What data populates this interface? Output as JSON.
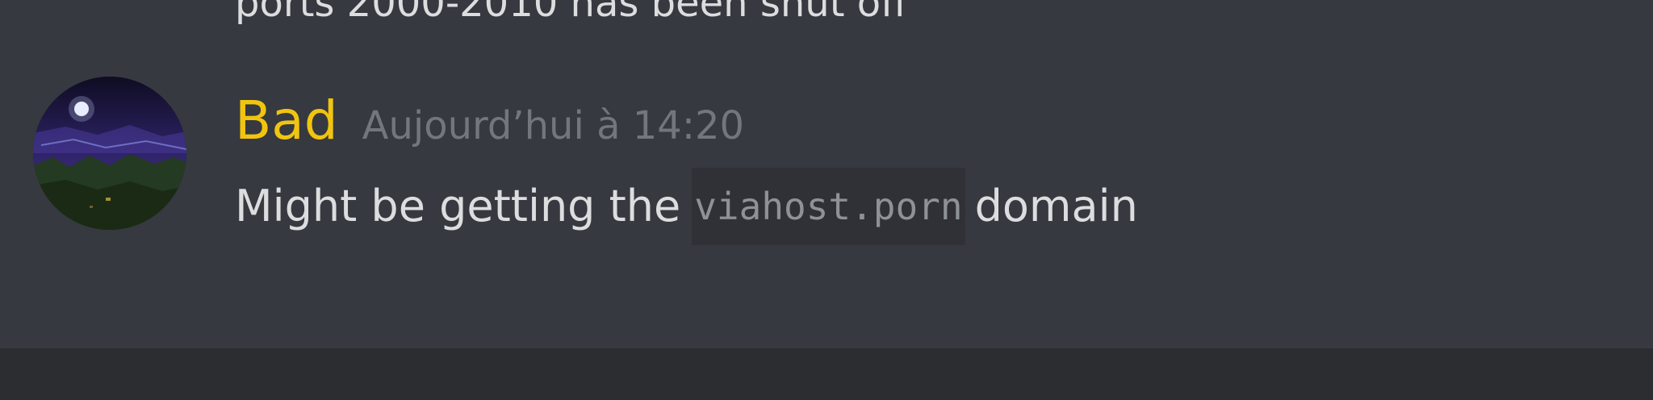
{
  "chat": {
    "previous_message_tail": "ports 2000-2010 has been shut off"
  },
  "message": {
    "avatar_icon": "night-sky-avatar",
    "username": "Bad",
    "username_color": "#f1c40f",
    "timestamp": "Aujourd’hui à 14:20",
    "text_before": "Might be getting the",
    "code": "viahost.porn",
    "text_after": "domain"
  }
}
